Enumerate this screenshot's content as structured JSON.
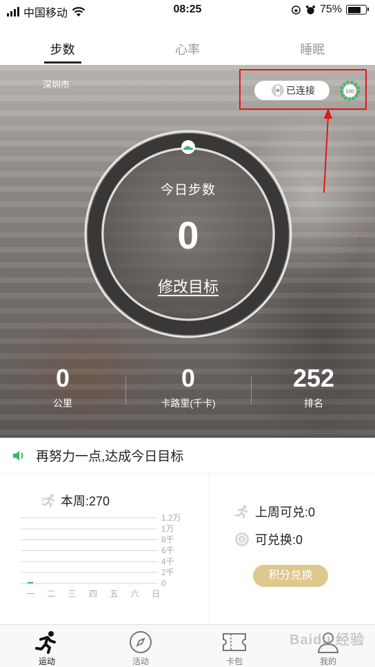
{
  "status_bar": {
    "carrier": "中国移动",
    "time": "08:25",
    "battery": "75%"
  },
  "tabs": [
    {
      "label": "步数",
      "active": true
    },
    {
      "label": "心率",
      "active": false
    },
    {
      "label": "睡眠",
      "active": false
    }
  ],
  "hero": {
    "city": "深圳市",
    "connect_label": "已连接",
    "device_battery": "100",
    "ring_title": "今日步数",
    "steps_today": "0",
    "edit_goal": "修改目标",
    "stats": [
      {
        "value": "0",
        "label": "公里"
      },
      {
        "value": "0",
        "label": "卡路里(千卡)"
      },
      {
        "value": "252",
        "label": "排名"
      }
    ]
  },
  "message": "再努力一点,达成今日目标",
  "week": {
    "label": "本周:270",
    "y_ticks": [
      "1.2万",
      "1万",
      "8千",
      "6千",
      "4千",
      "2千",
      "0"
    ],
    "days": [
      "一",
      "二",
      "三",
      "四",
      "五",
      "六",
      "日"
    ],
    "values": [
      270,
      0,
      0,
      0,
      0,
      0,
      0
    ]
  },
  "redeem": {
    "last_week": "上周可兑:0",
    "available": "可兑换:0",
    "button": "积分兑换"
  },
  "nav": [
    {
      "label": "运动",
      "icon": "runner-icon",
      "active": true
    },
    {
      "label": "活动",
      "icon": "compass-icon",
      "active": false
    },
    {
      "label": "卡包",
      "icon": "card-icon",
      "active": false
    },
    {
      "label": "我的",
      "icon": "profile-icon",
      "active": false
    }
  ],
  "watermark": "Baidu 经验",
  "colors": {
    "highlight_box": "#e2161b",
    "accent_green": "#3bb86a",
    "redeem_button": "#ddc98d"
  }
}
